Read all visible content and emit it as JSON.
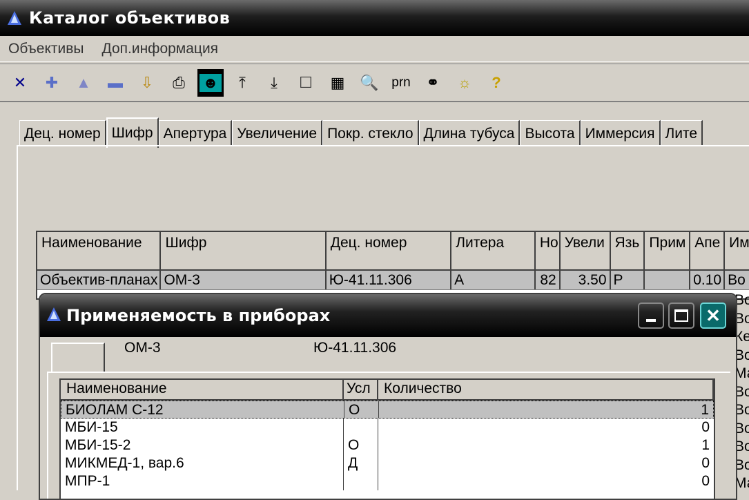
{
  "window": {
    "title": "Каталог объективов"
  },
  "menu": [
    "Объективы",
    "Доп.информация"
  ],
  "toolbar": {
    "buttons": [
      {
        "icon": "delete-x-icon",
        "glyph": "✕",
        "color": "#00008b"
      },
      {
        "icon": "insert-plus-icon",
        "glyph": "✚",
        "color": "#5a6fc8"
      },
      {
        "icon": "up-triangle-icon",
        "glyph": "▲",
        "color": "#7f86c6"
      },
      {
        "icon": "minus-icon",
        "glyph": "▬",
        "color": "#5a6fc8"
      },
      {
        "icon": "import-icon",
        "glyph": "⇩",
        "color": "#b8860b"
      },
      {
        "icon": "print-icon",
        "glyph": "⎙",
        "color": "#000"
      },
      {
        "icon": "portrait-icon",
        "glyph": "☻",
        "color": "#00a0a0"
      },
      {
        "icon": "arrow-top-icon",
        "glyph": "⤒",
        "color": "#000"
      },
      {
        "icon": "arrow-bottom-icon",
        "glyph": "⤓",
        "color": "#000"
      },
      {
        "icon": "checkbox-icon",
        "glyph": "☐",
        "color": "#333"
      },
      {
        "icon": "calculator-icon",
        "glyph": "▦",
        "color": "#000"
      },
      {
        "icon": "preview-icon",
        "glyph": "🔍",
        "color": "#000"
      }
    ],
    "prn_label": "prn",
    "buttons2": [
      {
        "icon": "binoculars-icon",
        "glyph": "⚭",
        "color": "#000"
      },
      {
        "icon": "lightbulb-icon",
        "glyph": "☼",
        "color": "#b8a000"
      },
      {
        "icon": "help-icon",
        "glyph": "?",
        "color": "#c8a000"
      }
    ]
  },
  "tabs": [
    "Дец. номер",
    "Шифр",
    "Апертура",
    "Увеличение",
    "Покр. стекло",
    "Длина тубуса",
    "Высота",
    "Иммерсия",
    "Лите"
  ],
  "grid": {
    "headers": [
      "Наименование",
      "Шифр",
      "Дец. номер",
      "Литера",
      "Но",
      "Увели",
      "Язь",
      "Прим",
      "Апе",
      "Им"
    ],
    "row": [
      "Объектив-планах",
      "ОМ-3",
      "Ю-41.11.306",
      "А",
      "82",
      "3.50",
      "Р",
      "",
      "0.10",
      "Во"
    ],
    "right_col": [
      "Во",
      "Во",
      "Ке",
      "Во",
      "Ма",
      "Во",
      "Во",
      "Во",
      "Во",
      "Во",
      "Ма"
    ]
  },
  "dialog": {
    "title": "Применяемость в приборах",
    "code": "ОМ-3",
    "dec_number": "Ю-41.11.306",
    "headers": [
      "Наименование",
      "Усл",
      "Количество"
    ],
    "rows": [
      {
        "name": "БИОЛАМ С-12",
        "cond": "О",
        "qty": "1"
      },
      {
        "name": "МБИ-15",
        "cond": "",
        "qty": "0"
      },
      {
        "name": "МБИ-15-2",
        "cond": "О",
        "qty": "1"
      },
      {
        "name": "МИКМЕД-1, вар.6",
        "cond": "Д",
        "qty": "0"
      },
      {
        "name": "МПР-1",
        "cond": "",
        "qty": "0"
      }
    ]
  }
}
